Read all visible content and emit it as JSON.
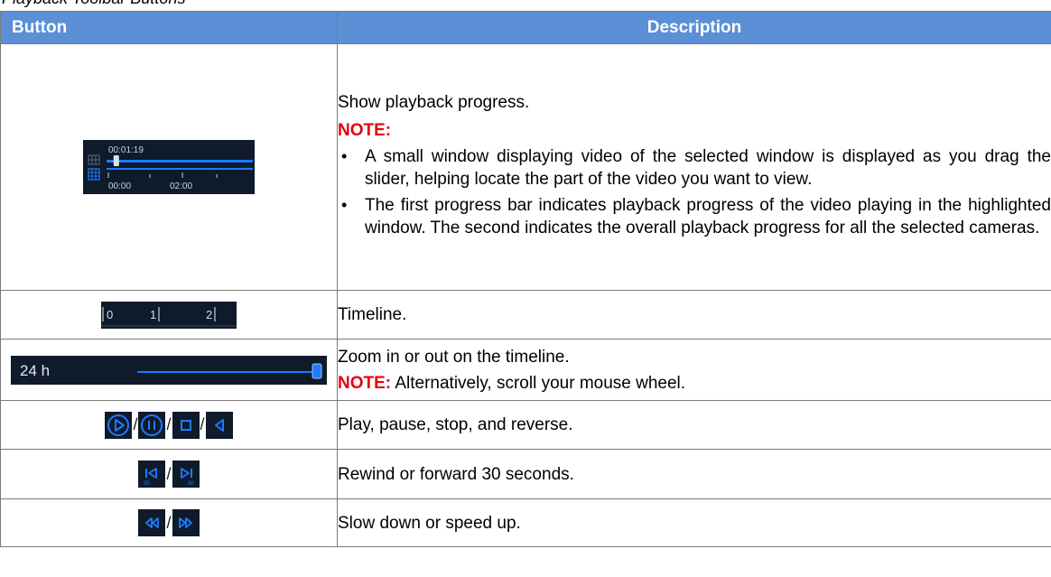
{
  "caption": "Playback Toolbar Buttons",
  "header": {
    "button": "Button",
    "description": "Description"
  },
  "rows": [
    {
      "desc": "Show playback progress.",
      "note_label": "NOTE:",
      "bullets": [
        "A small window displaying video of the selected window is displayed as you drag the slider, helping locate the part of the video you want to view.",
        "The first progress bar indicates playback progress of the video playing in the highlighted window. The second indicates the overall playback progress for all the selected cameras."
      ],
      "icon": {
        "time": "00:01:19",
        "tick_start": "00:00",
        "tick_mid": "02:00",
        "progress": 0.05
      }
    },
    {
      "desc": "Timeline.",
      "icon": {
        "t0": "0",
        "t1": "1",
        "t2": "2"
      }
    },
    {
      "desc": "Zoom in or out on the timeline.",
      "note_label": "NOTE:",
      "note_text": " Alternatively, scroll your mouse wheel.",
      "icon": {
        "label": "24 h",
        "level": 1.0
      }
    },
    {
      "desc": "Play, pause, stop, and reverse.",
      "icons": [
        "play-icon",
        "pause-icon",
        "stop-icon",
        "reverse-icon"
      ],
      "sep": "/"
    },
    {
      "desc": "Rewind or forward 30 seconds.",
      "icons": [
        "rewind-30-icon",
        "forward-30-icon"
      ],
      "sep": "/",
      "badge": "30"
    },
    {
      "desc": "Slow down or speed up.",
      "icons": [
        "slow-down-icon",
        "speed-up-icon"
      ],
      "sep": "/"
    }
  ],
  "colors": {
    "header_bg": "#5b8fd6",
    "note": "#e3000f",
    "icon_bg": "#0f1a2b",
    "accent": "#1e7bff"
  }
}
